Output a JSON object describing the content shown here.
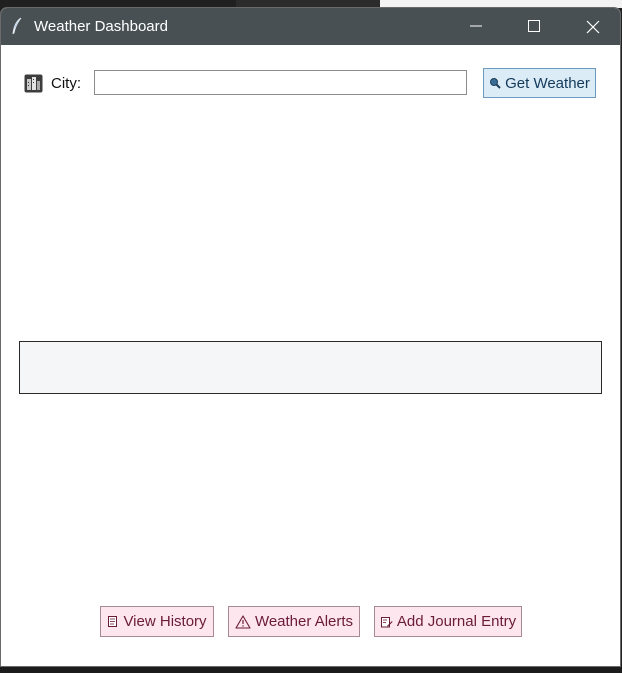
{
  "window": {
    "title": "Weather Dashboard",
    "controls": {
      "minimize": "minimize-icon",
      "maximize": "maximize-icon",
      "close": "close-icon"
    }
  },
  "search": {
    "city_label": "City:",
    "city_value": "",
    "city_placeholder": "",
    "get_weather_label": "Get Weather",
    "get_weather_icon": "magnifier-icon"
  },
  "result": {
    "text": ""
  },
  "actions": {
    "view_history": {
      "label": "View History",
      "icon": "scroll-icon"
    },
    "weather_alerts": {
      "label": "Weather Alerts",
      "icon": "warning-icon"
    },
    "add_journal": {
      "label": "Add Journal Entry",
      "icon": "memo-icon"
    }
  },
  "colors": {
    "titlebar": "#485054",
    "get_button_bg": "#dcecf6",
    "action_button_bg": "#fde6ee",
    "action_text": "#6a1b37"
  }
}
